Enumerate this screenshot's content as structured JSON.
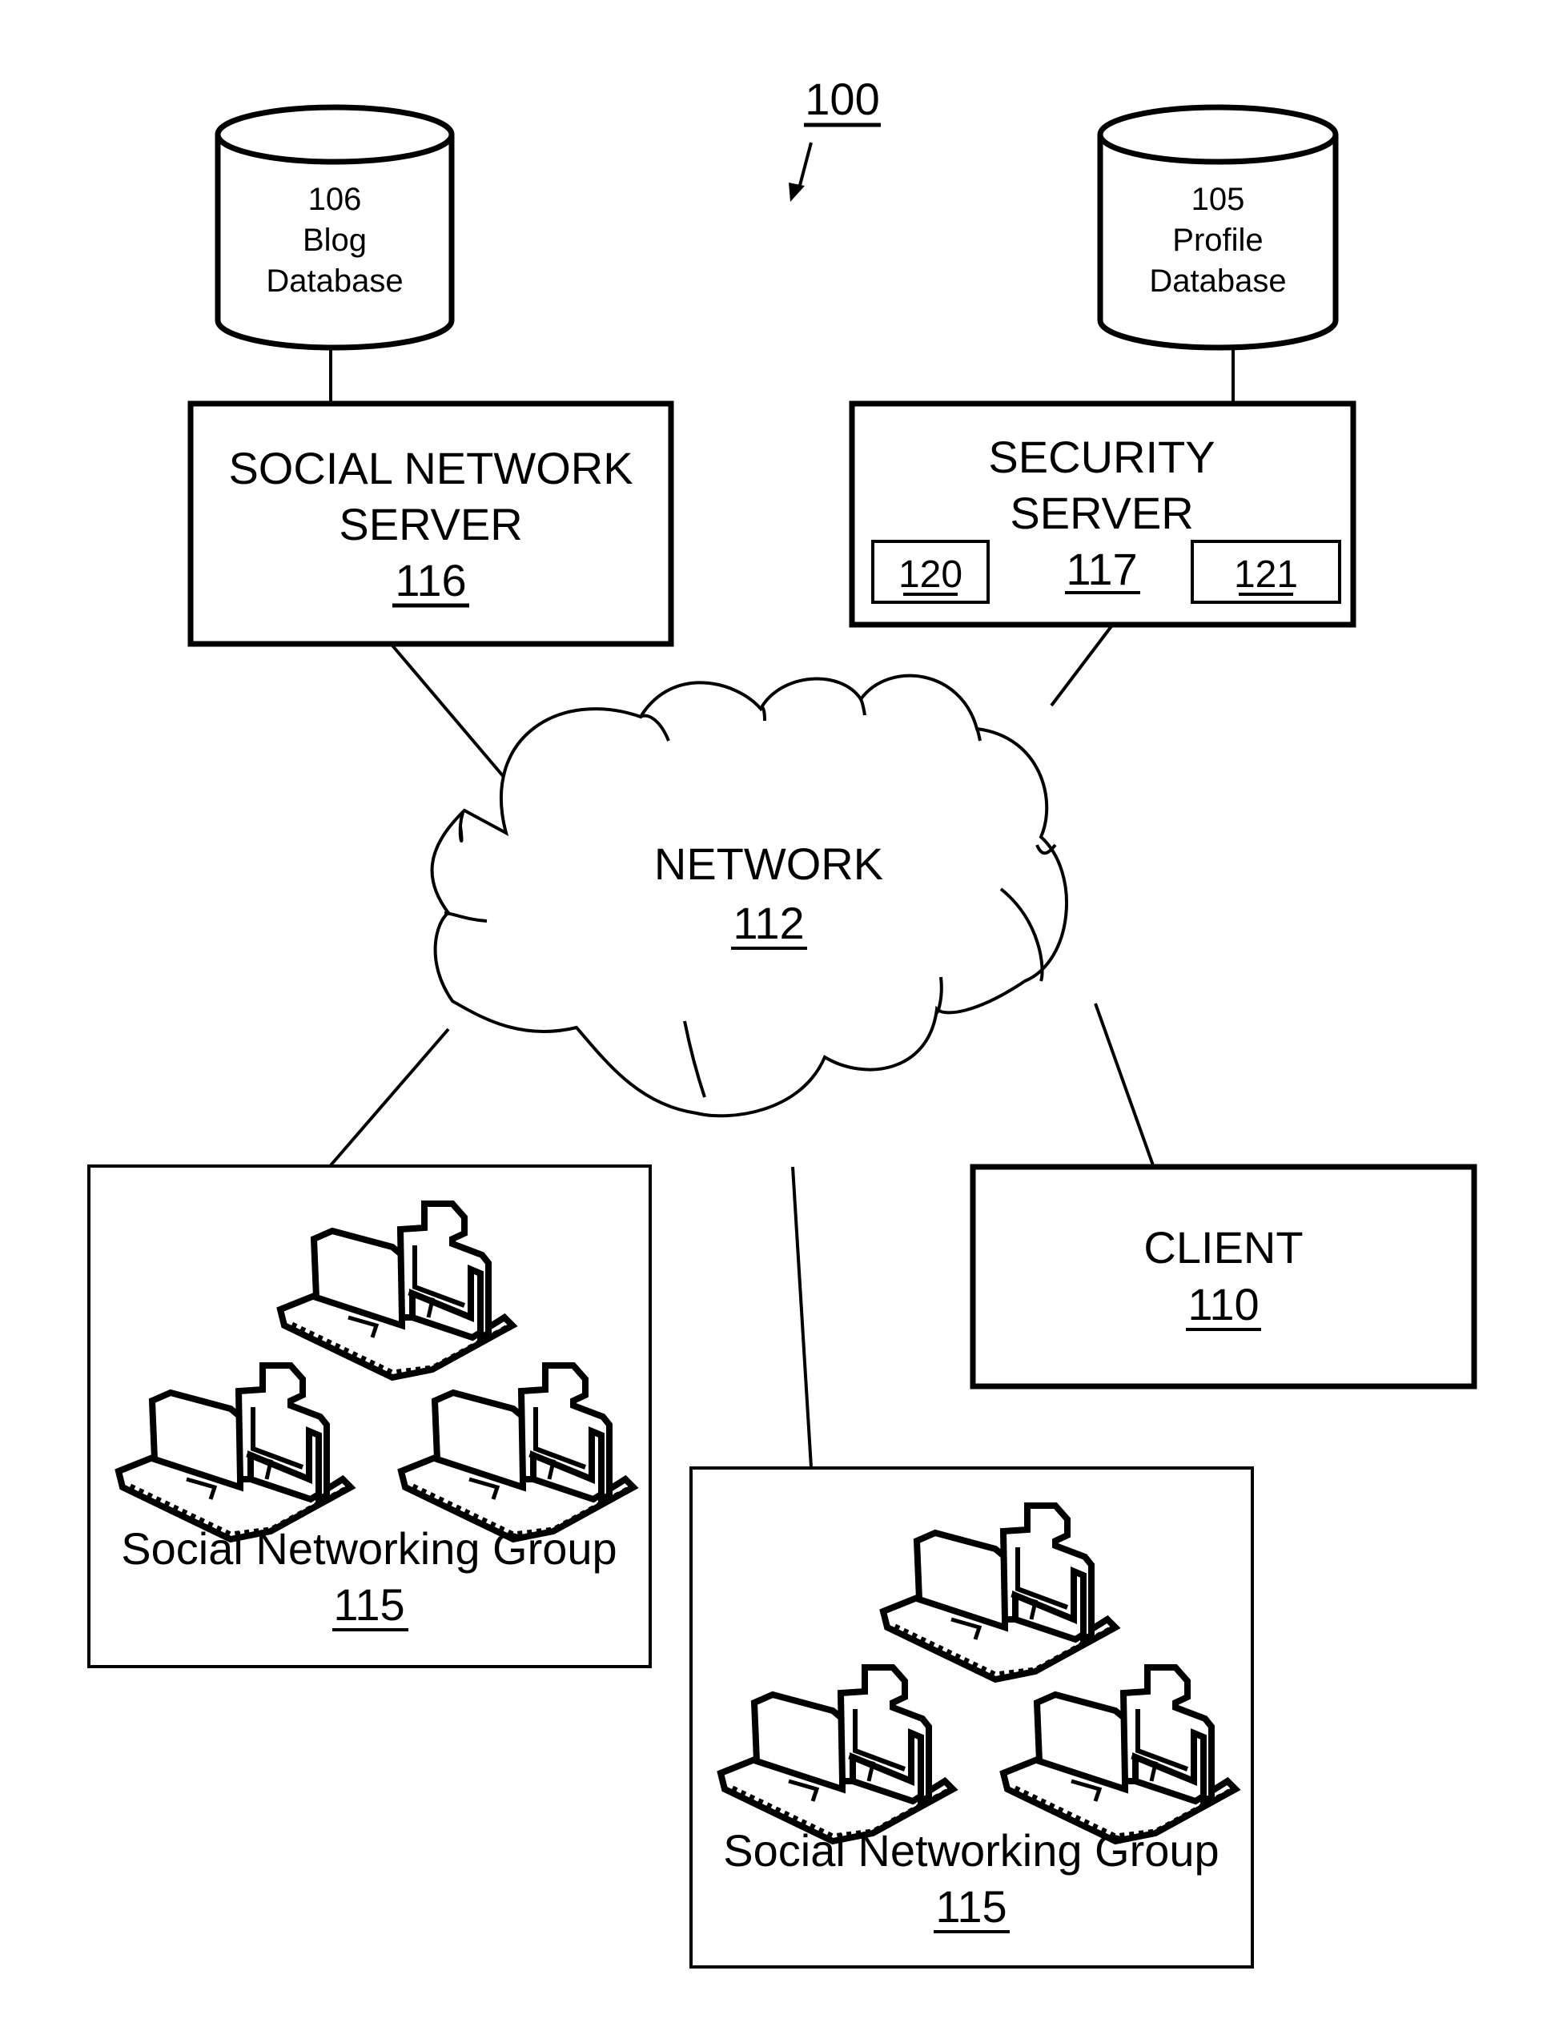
{
  "figure": {
    "ref": "100"
  },
  "databases": [
    {
      "id": "blog-db",
      "ref": "106",
      "line1": "Blog",
      "line2": "Database"
    },
    {
      "id": "profile-db",
      "ref": "105",
      "line1": "Profile",
      "line2": "Database"
    }
  ],
  "social_network_server": {
    "line1": "SOCIAL NETWORK",
    "line2": "SERVER",
    "ref": "116"
  },
  "security_server": {
    "line1": "SECURITY",
    "line2": "SERVER",
    "ref": "117",
    "modules": [
      {
        "ref": "120"
      },
      {
        "ref": "121"
      }
    ]
  },
  "network": {
    "label": "NETWORK",
    "ref": "112"
  },
  "client": {
    "label": "CLIENT",
    "ref": "110"
  },
  "groups": [
    {
      "label": "Social Networking Group",
      "ref": "115",
      "icon": "workstation-icon",
      "icon_count": 3
    },
    {
      "label": "Social Networking Group",
      "ref": "115",
      "icon": "workstation-icon",
      "icon_count": 3
    }
  ]
}
